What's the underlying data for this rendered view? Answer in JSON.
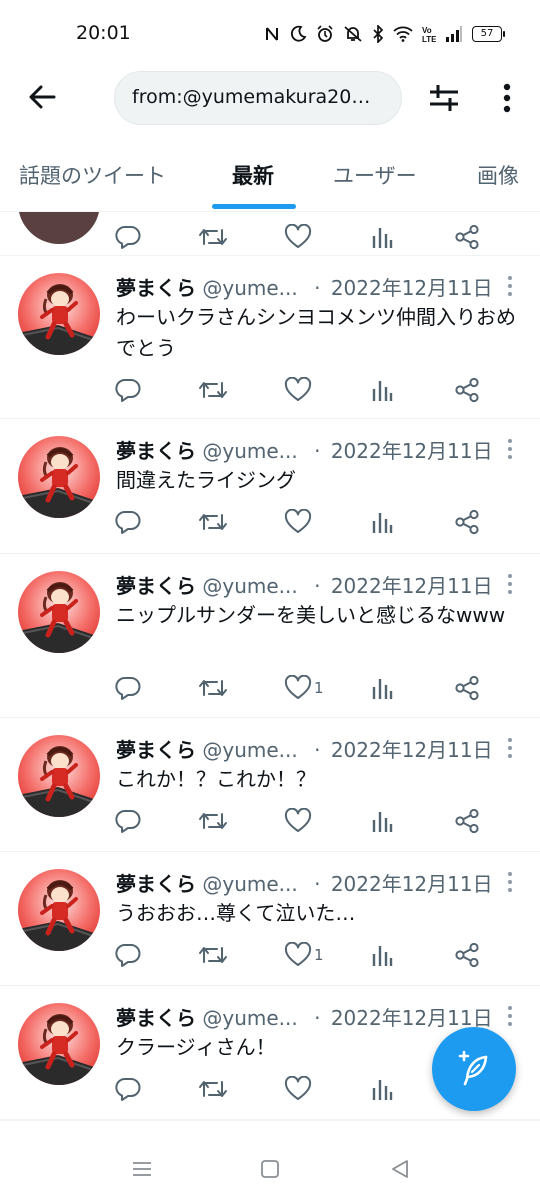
{
  "status_bar": {
    "time": "20:01",
    "battery": "57"
  },
  "search": {
    "query": "from:@yumemakura20…"
  },
  "tabs": [
    {
      "label": "話題のツイート"
    },
    {
      "label": "最新"
    },
    {
      "label": "ユーザー"
    },
    {
      "label": "画像"
    }
  ],
  "colors": {
    "accent": "#1d9bf0",
    "text": "#0f1419",
    "muted": "#536471",
    "avatar_bg": "#f0524f"
  },
  "tweets": [
    {
      "name": "夢まくら",
      "handle": "@yume...",
      "dot": "·",
      "date": "2022年12月11日",
      "text": "わーいクラさんシンヨコメンツ仲間入りおめでとう",
      "likes": ""
    },
    {
      "name": "夢まくら",
      "handle": "@yume...",
      "dot": "·",
      "date": "2022年12月11日",
      "text": "間違えたライジング",
      "likes": ""
    },
    {
      "name": "夢まくら",
      "handle": "@yume...",
      "dot": "·",
      "date": "2022年12月11日",
      "text": "ニップルサンダーを美しいと感じるなwww",
      "likes": "1"
    },
    {
      "name": "夢まくら",
      "handle": "@yume...",
      "dot": "·",
      "date": "2022年12月11日",
      "text": "これか！？これか！？",
      "likes": ""
    },
    {
      "name": "夢まくら",
      "handle": "@yume...",
      "dot": "·",
      "date": "2022年12月11日",
      "text": "うおおお…尊くて泣いた…",
      "likes": "1"
    },
    {
      "name": "夢まくら",
      "handle": "@yume...",
      "dot": "·",
      "date": "2022年12月11日",
      "text": "クラージィさん！",
      "likes": ""
    }
  ],
  "icons": {
    "back": "arrow-left-icon",
    "filter": "sliders-icon",
    "more": "more-vertical-icon",
    "reply": "reply-icon",
    "retweet": "retweet-icon",
    "like": "heart-icon",
    "views": "bar-chart-icon",
    "share": "share-icon",
    "compose": "compose-feather-icon"
  }
}
